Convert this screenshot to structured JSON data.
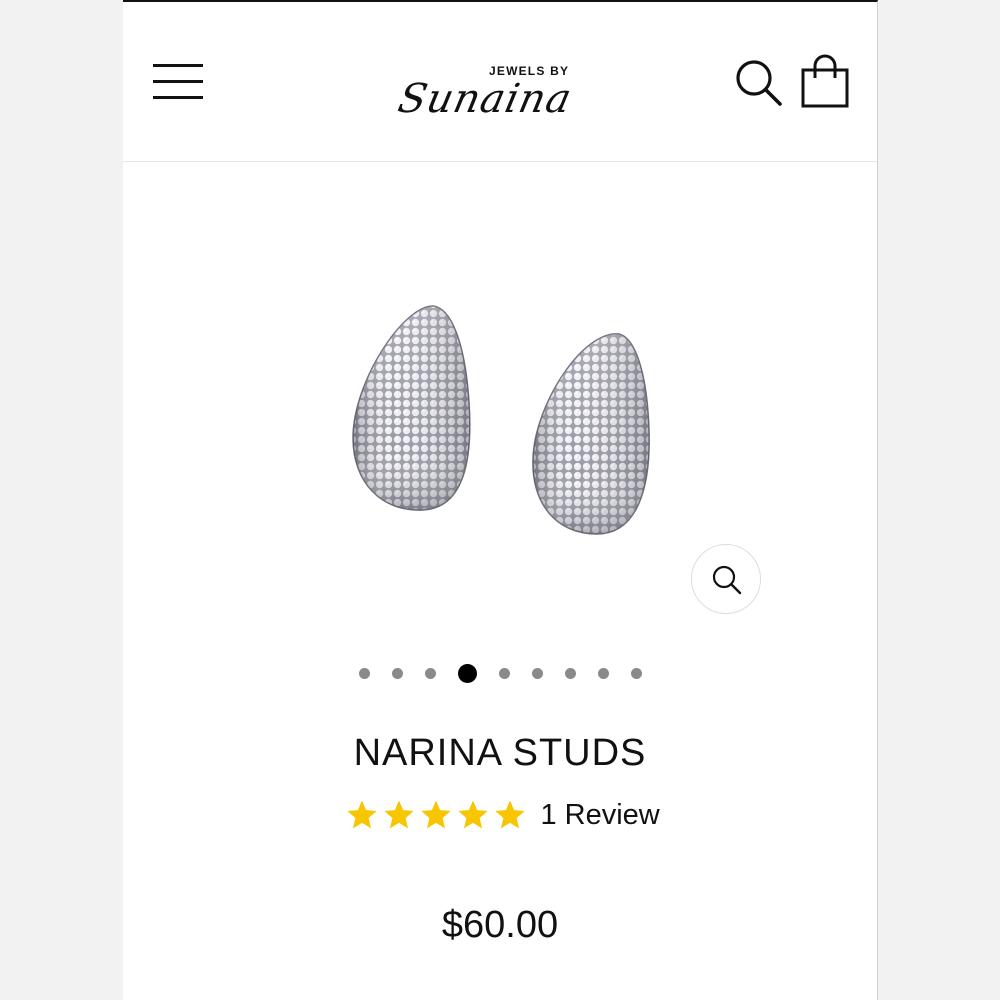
{
  "header": {
    "logo_small": "JEWELS BY",
    "logo_script": "Sunaina"
  },
  "icons": {
    "menu": "hamburger-menu-icon",
    "search": "search-icon",
    "cart": "shopping-bag-icon",
    "zoom": "zoom-icon",
    "star": "star-icon"
  },
  "gallery": {
    "image_alt": "Narina studs pavé teardrop earrings",
    "slide_count": 9,
    "active_slide": 4
  },
  "product": {
    "title": "NARINA STUDS",
    "rating": 5,
    "rating_max": 5,
    "review_label": "1 Review",
    "price": "$60.00"
  },
  "colors": {
    "star": "#f7c600",
    "text": "#111111",
    "dot_inactive": "#8a8a8a",
    "dot_active": "#000000"
  }
}
